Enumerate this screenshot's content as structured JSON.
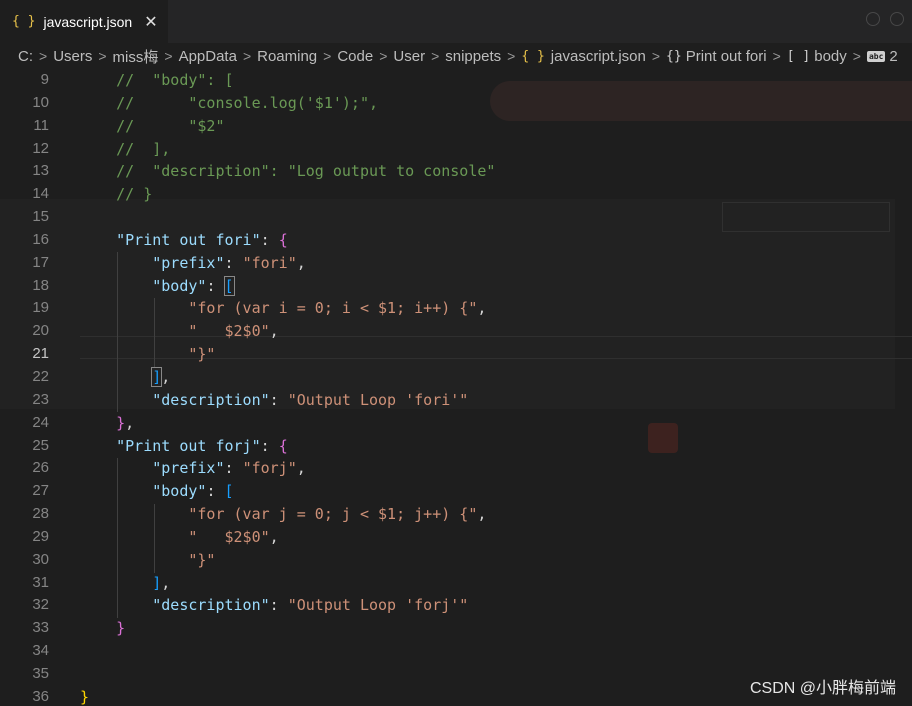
{
  "tab": {
    "icon": "{ }",
    "title": "javascript.json",
    "close": "✕"
  },
  "breadcrumb": {
    "items": [
      "C:",
      "Users",
      "miss梅",
      "AppData",
      "Roaming",
      "Code",
      "User",
      "snippets"
    ],
    "file": "javascript.json",
    "object": "Print out fori",
    "array": "body",
    "string": "2",
    "json_icon": "{ }",
    "object_icon": "{}",
    "array_icon": "[ ]",
    "string_icon": "abc",
    "separator": ">"
  },
  "editor": {
    "active_line": 21,
    "lines": [
      {
        "n": 9,
        "tokens": [
          [
            "c-comment",
            "//  \"body\": ["
          ]
        ]
      },
      {
        "n": 10,
        "tokens": [
          [
            "c-comment",
            "//      \"console.log('$1');\","
          ]
        ]
      },
      {
        "n": 11,
        "tokens": [
          [
            "c-comment",
            "//      \"$2\""
          ]
        ]
      },
      {
        "n": 12,
        "tokens": [
          [
            "c-comment",
            "//  ],"
          ]
        ]
      },
      {
        "n": 13,
        "tokens": [
          [
            "c-comment",
            "//  \"description\": \"Log output to console\""
          ]
        ]
      },
      {
        "n": 14,
        "tokens": [
          [
            "c-comment",
            "// }"
          ]
        ]
      },
      {
        "n": 15,
        "tokens": []
      },
      {
        "n": 16,
        "tokens": [
          [
            "c-key",
            "\"Print out fori\""
          ],
          [
            "c-punc",
            ": "
          ],
          [
            "c-br1",
            "{"
          ]
        ]
      },
      {
        "n": 17,
        "tokens": [
          [
            "c-punc",
            "    "
          ],
          [
            "c-key",
            "\"prefix\""
          ],
          [
            "c-punc",
            ": "
          ],
          [
            "c-str",
            "\"fori\""
          ],
          [
            "c-punc",
            ","
          ]
        ]
      },
      {
        "n": 18,
        "tokens": [
          [
            "c-punc",
            "    "
          ],
          [
            "c-key",
            "\"body\""
          ],
          [
            "c-punc",
            ": "
          ],
          [
            "c-br2 bracket-match",
            "["
          ]
        ]
      },
      {
        "n": 19,
        "tokens": [
          [
            "c-punc",
            "        "
          ],
          [
            "c-str",
            "\"for (var i = 0; i < $1; i++) {\""
          ],
          [
            "c-punc",
            ","
          ]
        ]
      },
      {
        "n": 20,
        "tokens": [
          [
            "c-punc",
            "        "
          ],
          [
            "c-str",
            "\"   $2$0\""
          ],
          [
            "c-punc",
            ","
          ]
        ]
      },
      {
        "n": 21,
        "tokens": [
          [
            "c-punc",
            "        "
          ],
          [
            "c-str",
            "\"}\""
          ]
        ]
      },
      {
        "n": 22,
        "tokens": [
          [
            "c-punc",
            "    "
          ],
          [
            "c-br2 bracket-match",
            "]"
          ],
          [
            "c-punc",
            ","
          ]
        ]
      },
      {
        "n": 23,
        "tokens": [
          [
            "c-punc",
            "    "
          ],
          [
            "c-key",
            "\"description\""
          ],
          [
            "c-punc",
            ": "
          ],
          [
            "c-str",
            "\"Output Loop 'fori'\""
          ]
        ]
      },
      {
        "n": 24,
        "tokens": [
          [
            "c-br1",
            "}"
          ],
          [
            "c-punc",
            ","
          ]
        ]
      },
      {
        "n": 25,
        "tokens": [
          [
            "c-key",
            "\"Print out forj\""
          ],
          [
            "c-punc",
            ": "
          ],
          [
            "c-br1",
            "{"
          ]
        ]
      },
      {
        "n": 26,
        "tokens": [
          [
            "c-punc",
            "    "
          ],
          [
            "c-key",
            "\"prefix\""
          ],
          [
            "c-punc",
            ": "
          ],
          [
            "c-str",
            "\"forj\""
          ],
          [
            "c-punc",
            ","
          ]
        ]
      },
      {
        "n": 27,
        "tokens": [
          [
            "c-punc",
            "    "
          ],
          [
            "c-key",
            "\"body\""
          ],
          [
            "c-punc",
            ": "
          ],
          [
            "c-br2",
            "["
          ]
        ]
      },
      {
        "n": 28,
        "tokens": [
          [
            "c-punc",
            "        "
          ],
          [
            "c-str",
            "\"for (var j = 0; j < $1; j++) {\""
          ],
          [
            "c-punc",
            ","
          ]
        ]
      },
      {
        "n": 29,
        "tokens": [
          [
            "c-punc",
            "        "
          ],
          [
            "c-str",
            "\"   $2$0\""
          ],
          [
            "c-punc",
            ","
          ]
        ]
      },
      {
        "n": 30,
        "tokens": [
          [
            "c-punc",
            "        "
          ],
          [
            "c-str",
            "\"}\""
          ]
        ]
      },
      {
        "n": 31,
        "tokens": [
          [
            "c-punc",
            "    "
          ],
          [
            "c-br2",
            "]"
          ],
          [
            "c-punc",
            ","
          ]
        ]
      },
      {
        "n": 32,
        "tokens": [
          [
            "c-punc",
            "    "
          ],
          [
            "c-key",
            "\"description\""
          ],
          [
            "c-punc",
            ": "
          ],
          [
            "c-str",
            "\"Output Loop 'forj'\""
          ]
        ]
      },
      {
        "n": 33,
        "tokens": [
          [
            "c-br1",
            "}"
          ]
        ]
      },
      {
        "n": 34,
        "tokens": []
      },
      {
        "n": 35,
        "tokens": []
      },
      {
        "n": 36,
        "tokens": [
          [
            "c-br0",
            "}"
          ]
        ]
      }
    ]
  },
  "watermark": "CSDN @小胖梅前端"
}
